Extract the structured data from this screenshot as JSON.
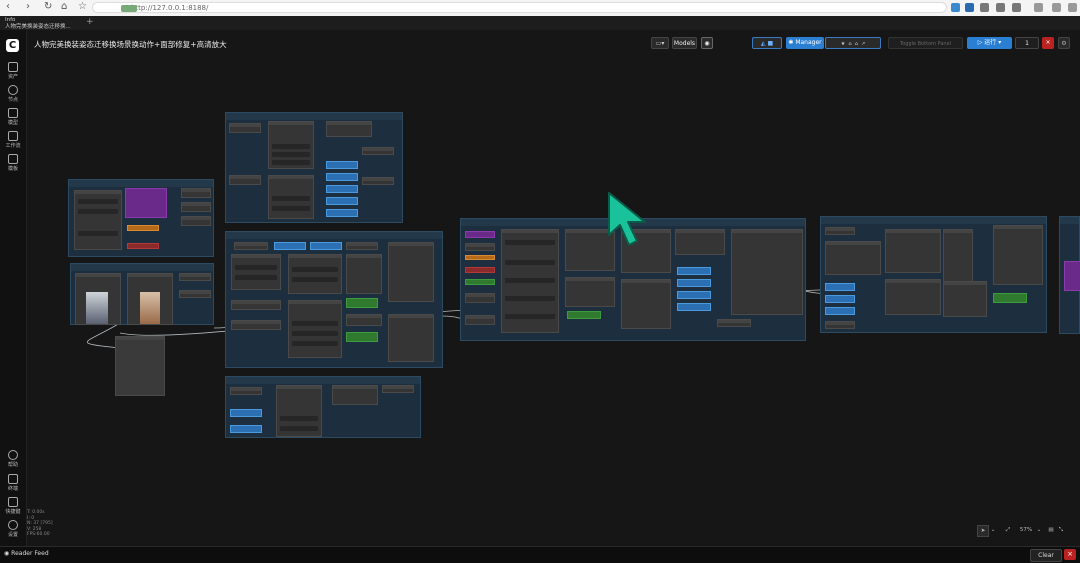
{
  "browser": {
    "url": "http://127.0.0.1:8188/",
    "tab_title_line1": "Info",
    "tab_title_line2": "人物完美换装姿态迁移换...",
    "new_tab": "+",
    "nav": {
      "back": "‹",
      "forward": "›",
      "reload": "↻",
      "home": "⌂",
      "star": "☆"
    }
  },
  "app": {
    "workflow_title": "人物完美换装姿态迁移换场景换动作+面部修复+高清放大",
    "title_caret": "▾",
    "folder_caret": "▾",
    "models_button": "Models",
    "manager_button": "Manager",
    "toggle_placeholder": "Toggle Bottom Panel",
    "run_button": "运行",
    "run_caret": "▾",
    "queue_count": "1",
    "cancel": "×"
  },
  "sidebar": {
    "logo": "C",
    "items": [
      {
        "label": "资产",
        "icon": "image-icon"
      },
      {
        "label": "节点",
        "icon": "node-icon"
      },
      {
        "label": "模型",
        "icon": "model-icon"
      },
      {
        "label": "工作流",
        "icon": "workflow-icon"
      },
      {
        "label": "模板",
        "icon": "template-icon"
      }
    ],
    "bottom_items": [
      {
        "label": "帮助",
        "icon": "help-icon"
      },
      {
        "label": "终端",
        "icon": "terminal-icon"
      },
      {
        "label": "快捷键",
        "icon": "keyboard-icon"
      },
      {
        "label": "设置",
        "icon": "settings-icon"
      }
    ],
    "stats": [
      "T: 0.00s",
      "I: 0",
      "N: 37 [795]",
      "V: 258",
      "FPS:60.00"
    ]
  },
  "canvas": {
    "zoom": "57%"
  },
  "footer": {
    "reader_label": "Reader Feed",
    "clear_button": "Clear",
    "close": "×"
  }
}
